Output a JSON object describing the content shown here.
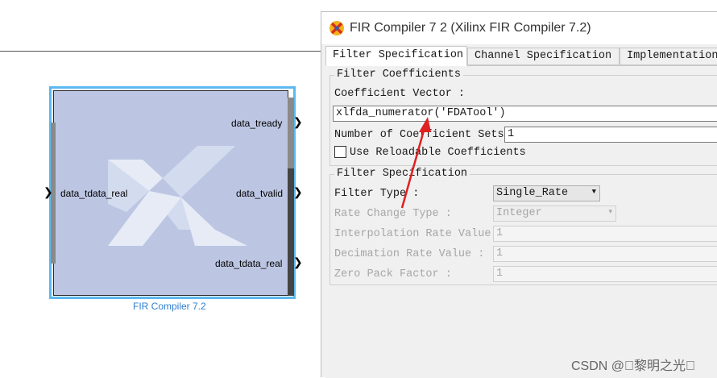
{
  "block": {
    "caption": "FIR Compiler 7.2",
    "ports": {
      "input": "data_tdata_real",
      "out_tready": "data_tready",
      "out_tvalid": "data_tvalid",
      "out_tdata": "data_tdata_real"
    }
  },
  "dialog": {
    "title": "FIR Compiler 7 2  (Xilinx FIR Compiler 7.2)",
    "tabs": [
      "Filter Specification",
      "Channel Specification",
      "Implementation"
    ],
    "active_tab": "Filter Specification",
    "coefficients_group": {
      "legend": "Filter Coefficients",
      "vector_label": "Coefficient Vector :",
      "vector_value": "xlfda_numerator('FDATool')",
      "sets_label": "Number of Coefficient Sets :",
      "sets_value": "1",
      "reloadable_label": "Use Reloadable Coefficients",
      "reloadable_checked": false
    },
    "spec_group": {
      "legend": "Filter Specification",
      "filter_type_label": "Filter Type :",
      "filter_type_value": "Single_Rate",
      "rate_change_label": "Rate Change Type :",
      "rate_change_value": "Integer",
      "interp_label": "Interpolation Rate Value :",
      "interp_value": "1",
      "decim_label": "Decimation Rate Value :",
      "decim_value": "1",
      "zero_pack_label": "Zero Pack Factor :",
      "zero_pack_value": "1"
    }
  },
  "watermark": "CSDN @\u0000黎明之光\u0000",
  "colors": {
    "block_border": "#5cb8f0",
    "block_fill": "#bcc6e2",
    "caption": "#2f7fd0",
    "annotation_arrow": "#e02020"
  }
}
